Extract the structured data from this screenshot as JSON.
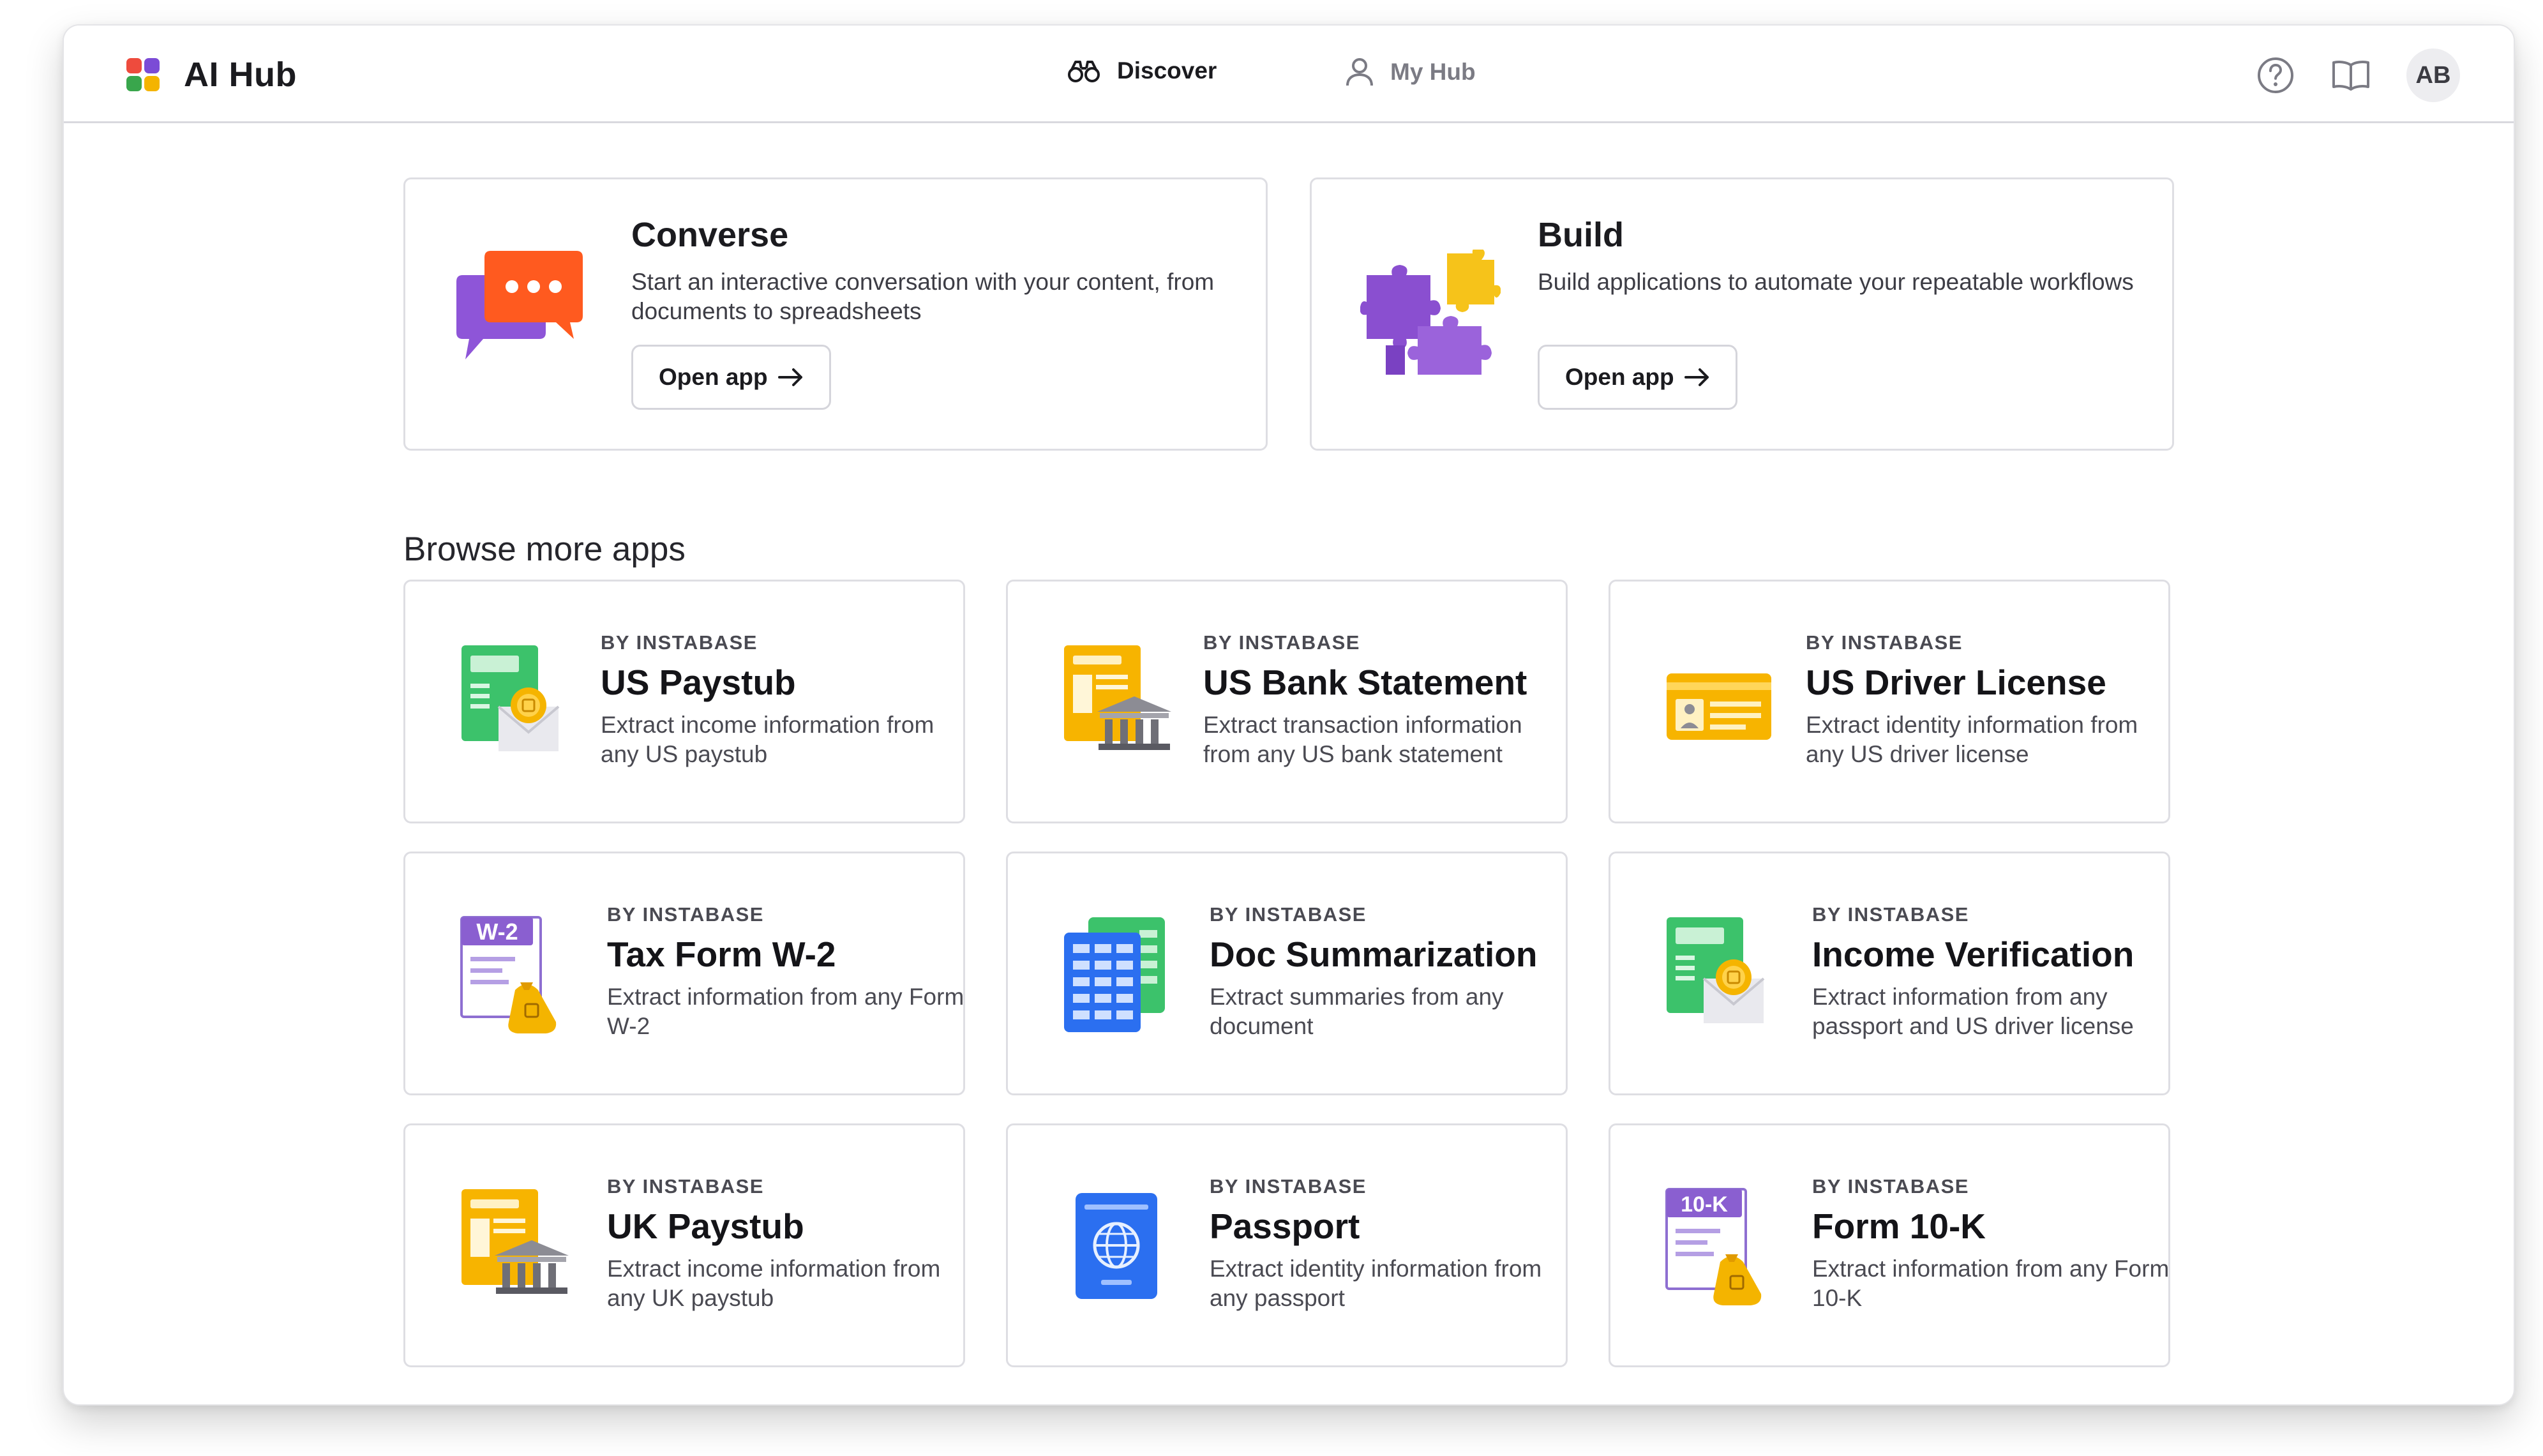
{
  "app": {
    "title": "AI Hub"
  },
  "nav": {
    "discover": "Discover",
    "my_hub": "My Hub"
  },
  "user": {
    "initials": "AB"
  },
  "features": [
    {
      "title": "Converse",
      "description": "Start an interactive conversation with your content, from documents to spreadsheets",
      "button": "Open app"
    },
    {
      "title": "Build",
      "description": "Build applications to automate your repeatable workflows",
      "button": "Open app"
    }
  ],
  "browse": {
    "title": "Browse more apps",
    "apps": [
      {
        "by": "BY INSTABASE",
        "title": "US Paystub",
        "description": "Extract income information from any US paystub",
        "icon": "paystub-money-icon"
      },
      {
        "by": "BY INSTABASE",
        "title": "US Bank Statement",
        "description": "Extract transaction information from any US bank statement",
        "icon": "bank-statement-icon"
      },
      {
        "by": "BY INSTABASE",
        "title": "US Driver License",
        "description": "Extract identity information from any US driver license",
        "icon": "id-card-icon"
      },
      {
        "by": "BY INSTABASE",
        "title": "Tax Form W-2",
        "description": "Extract information from any Form W-2",
        "icon": "w2-form-icon",
        "badge": "W-2"
      },
      {
        "by": "BY INSTABASE",
        "title": "Doc Summarization",
        "description": "Extract summaries from any document",
        "icon": "spreadsheet-icon"
      },
      {
        "by": "BY INSTABASE",
        "title": "Income Verification",
        "description": "Extract information from any passport and US driver license",
        "icon": "paystub-money-icon"
      },
      {
        "by": "BY INSTABASE",
        "title": "UK Paystub",
        "description": "Extract income information from any UK paystub",
        "icon": "bank-statement-icon"
      },
      {
        "by": "BY INSTABASE",
        "title": "Passport",
        "description": "Extract identity information from any passport",
        "icon": "passport-icon"
      },
      {
        "by": "BY INSTABASE",
        "title": "Form 10-K",
        "description": "Extract information from any Form 10-K",
        "icon": "form-10k-icon",
        "badge": "10-K"
      }
    ]
  },
  "colors": {
    "logo": [
      "#ee4b3d",
      "#7b4bd6",
      "#39a64c",
      "#f4b400"
    ],
    "converse_bubble_front": "#ff5a1f",
    "converse_bubble_back": "#8e55d8",
    "puzzle_purple": "#8a4fd0",
    "puzzle_yellow": "#f6c31a"
  }
}
